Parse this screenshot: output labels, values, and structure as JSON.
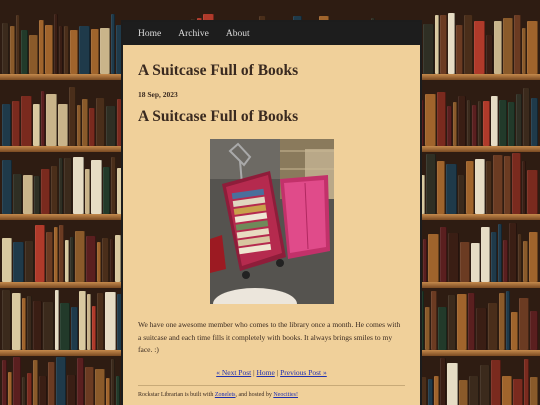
{
  "nav": {
    "items": [
      {
        "label": "Home"
      },
      {
        "label": "Archive"
      },
      {
        "label": "About"
      }
    ]
  },
  "page": {
    "title": "A Suitcase Full of Books"
  },
  "post": {
    "date": "18 Sep, 2023",
    "title": "A Suitcase Full of Books",
    "photo_subject": "rolling suitcase filled with books",
    "body": "We have one awesome member who comes to the library once a month. He comes with a suitcase and each time fills it completely with books. It always brings smiles to my face. :)"
  },
  "post_nav": {
    "next": "« Next Post",
    "sep1": " | ",
    "home": "Home",
    "sep2": " | ",
    "previous": "Previous Post »"
  },
  "footer": {
    "prefix": "Rockstar Librarian is built with ",
    "zonelets": "Zonelets",
    "middle": ", and hosted by ",
    "neocities": "Neocities!"
  },
  "colors": {
    "panel_bg": "#f0d09a",
    "nav_bg": "#1d1d1d",
    "link": "#1e2fb0",
    "text": "#3a2a20"
  }
}
